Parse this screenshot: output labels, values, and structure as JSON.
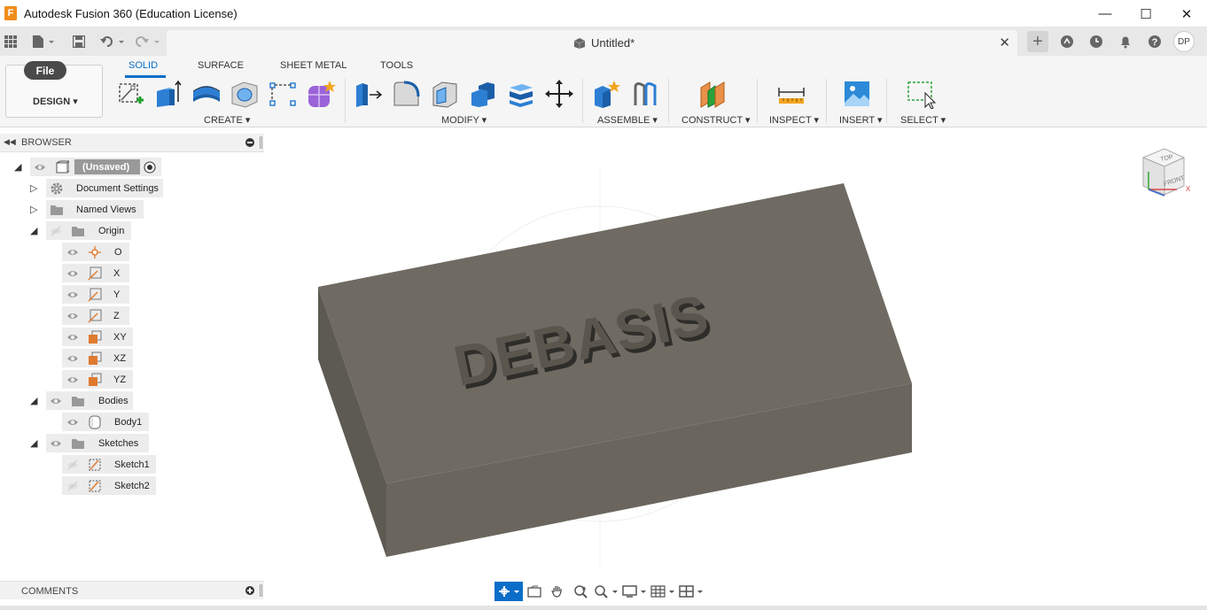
{
  "window": {
    "title": "Autodesk Fusion 360 (Education License)",
    "logo_letter": "F",
    "minimize": "—",
    "maximize": "☐",
    "close": "✕"
  },
  "document_tab": {
    "title": "Untitled*",
    "close": "✕"
  },
  "user": {
    "initials": "DP"
  },
  "ribbon": {
    "file_label": "File",
    "workspace": "DESIGN ▾",
    "tabs": [
      "SOLID",
      "SURFACE",
      "SHEET METAL",
      "TOOLS"
    ],
    "active_tab": "SOLID",
    "groups": {
      "create": "CREATE ▾",
      "modify": "MODIFY ▾",
      "assemble": "ASSEMBLE ▾",
      "construct": "CONSTRUCT ▾",
      "inspect": "INSPECT ▾",
      "insert": "INSERT ▾",
      "select": "SELECT ▾"
    }
  },
  "browser": {
    "title": "BROWSER",
    "root": "(Unsaved)",
    "items": {
      "document_settings": "Document Settings",
      "named_views": "Named Views",
      "origin": "Origin",
      "origin_o": "O",
      "origin_x": "X",
      "origin_y": "Y",
      "origin_z": "Z",
      "origin_xy": "XY",
      "origin_xz": "XZ",
      "origin_yz": "YZ",
      "bodies": "Bodies",
      "body1": "Body1",
      "sketches": "Sketches",
      "sketch1": "Sketch1",
      "sketch2": "Sketch2"
    }
  },
  "comments": {
    "title": "COMMENTS"
  },
  "model": {
    "engraved_text": "DEBASIS",
    "body_color": "#6f6b62"
  },
  "viewcube": {
    "top": "TOP",
    "front": "FRONT"
  },
  "colors": {
    "accent": "#0a6ec9",
    "logo": "#f08d1c"
  }
}
